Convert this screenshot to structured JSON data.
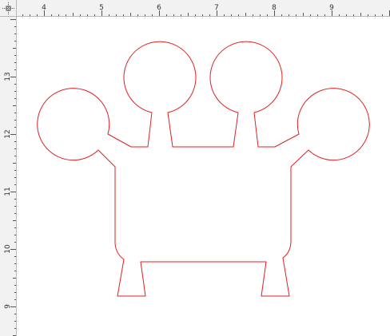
{
  "rulers": {
    "horizontal": [
      "4",
      "5",
      "6",
      "7",
      "8",
      "9"
    ],
    "vertical": [
      "13",
      "12",
      "11",
      "10",
      "9"
    ]
  },
  "colors": {
    "ruler_background": "#f2f2f2",
    "ruler_tick": "#555555",
    "canvas_background": "#ffffff",
    "outline": "#e02020"
  },
  "icons": {
    "corner": "ruler-origin-icon"
  }
}
